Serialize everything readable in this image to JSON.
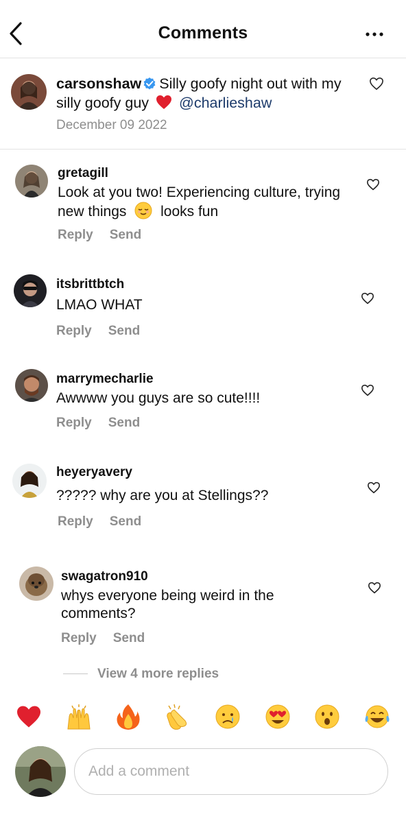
{
  "header": {
    "title": "Comments",
    "back_icon": "chevron-left-icon",
    "more_icon": "ellipsis-icon"
  },
  "caption": {
    "username": "carsonshaw",
    "verified": true,
    "text": "Silly goofy night out with my silly goofy guy",
    "mention": "@charlieshaw",
    "date": "December 09 2022"
  },
  "comments": [
    {
      "username": "gretagill",
      "text": "Look at you two! Experiencing culture, trying new things",
      "text_after_emoji": "looks fun",
      "reply_label": "Reply",
      "send_label": "Send"
    },
    {
      "username": "itsbrittbtch",
      "text": "LMAO WHAT",
      "reply_label": "Reply",
      "send_label": "Send"
    },
    {
      "username": "marrymecharlie",
      "text": "Awwww you guys are so cute!!!!",
      "reply_label": "Reply",
      "send_label": "Send"
    },
    {
      "username": "heyeryavery",
      "text": "????? why are you at Stellings??",
      "reply_label": "Reply",
      "send_label": "Send"
    },
    {
      "username": "swagatron910",
      "text": "whys everyone being weird in the comments?",
      "reply_label": "Reply",
      "send_label": "Send"
    }
  ],
  "view_replies": "View 4 more replies",
  "emoji_bar": [
    "❤️",
    "🙌",
    "🔥",
    "👏",
    "😢",
    "😍",
    "😮",
    "😂"
  ],
  "composer": {
    "placeholder": "Add a comment"
  },
  "colors": {
    "secondary_text": "#8e8e8e",
    "mention": "#1d3b6b",
    "verified": "#3897f0",
    "heart": "#e0245e"
  }
}
